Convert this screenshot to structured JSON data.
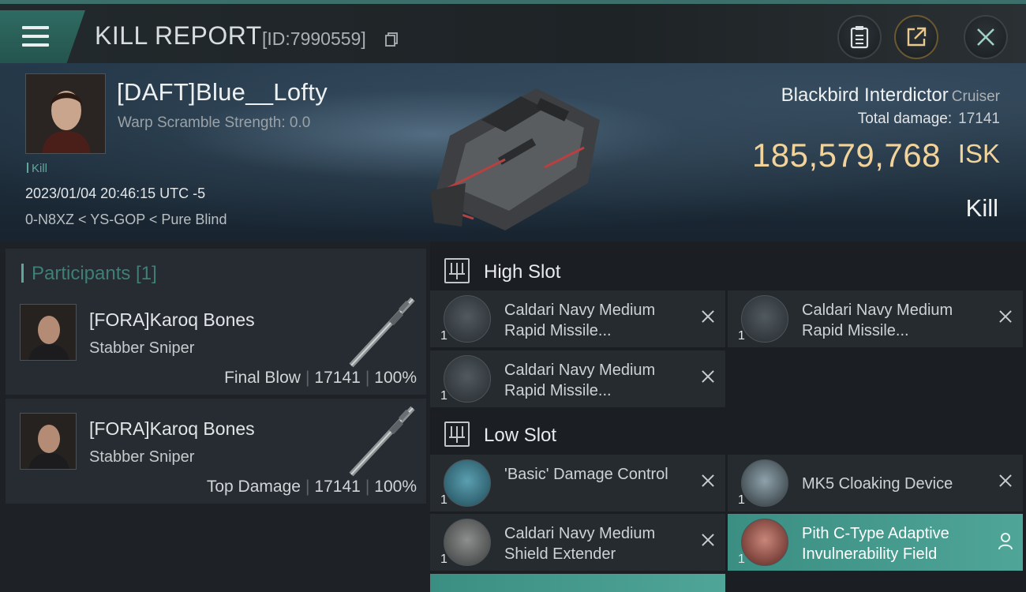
{
  "header": {
    "title": "KILL REPORT",
    "id_text": "[ID:7990559]",
    "icons": [
      "menu-icon",
      "copy-icon",
      "clipboard-icon",
      "share-icon",
      "close-icon"
    ]
  },
  "victim": {
    "name": "[DAFT]Blue__Lofty",
    "warp_scramble": "Warp Scramble Strength: 0.0",
    "kill_tag": "Kill",
    "datetime": "2023/01/04 20:46:15 UTC -5",
    "location": "0-N8XZ < YS-GOP < Pure Blind"
  },
  "ship": {
    "name": "Blackbird Interdictor",
    "class": "Cruiser",
    "total_damage_label": "Total damage:",
    "total_damage": "17141",
    "isk_value": "185,579,768",
    "isk_unit": "ISK",
    "result": "Kill"
  },
  "participants": {
    "title": "Participants [1]",
    "items": [
      {
        "name": "[FORA]Karoq Bones",
        "ship": "Stabber Sniper",
        "role": "Final Blow",
        "damage": "17141",
        "percent": "100%"
      },
      {
        "name": "[FORA]Karoq Bones",
        "ship": "Stabber Sniper",
        "role": "Top Damage",
        "damage": "17141",
        "percent": "100%"
      }
    ]
  },
  "fitting": {
    "high_slot_label": "High Slot",
    "low_slot_label": "Low Slot",
    "high": [
      {
        "name": "Caldari Navy Medium Rapid Missile...",
        "qty": "1"
      },
      {
        "name": "Caldari Navy Medium Rapid Missile...",
        "qty": "1"
      },
      {
        "name": "Caldari Navy Medium Rapid Missile...",
        "qty": "1"
      }
    ],
    "low": [
      {
        "name": "'Basic' Damage Control",
        "qty": "1"
      },
      {
        "name": "MK5 Cloaking Device",
        "qty": "1"
      },
      {
        "name": "Caldari Navy Medium Shield Extender",
        "qty": "1"
      },
      {
        "name": "Pith C-Type Adaptive Invulnerability Field",
        "qty": "1"
      }
    ],
    "highlight_color": "#4fa597"
  },
  "colors": {
    "isk": "#f2d49a",
    "accent": "#5fa79b"
  }
}
